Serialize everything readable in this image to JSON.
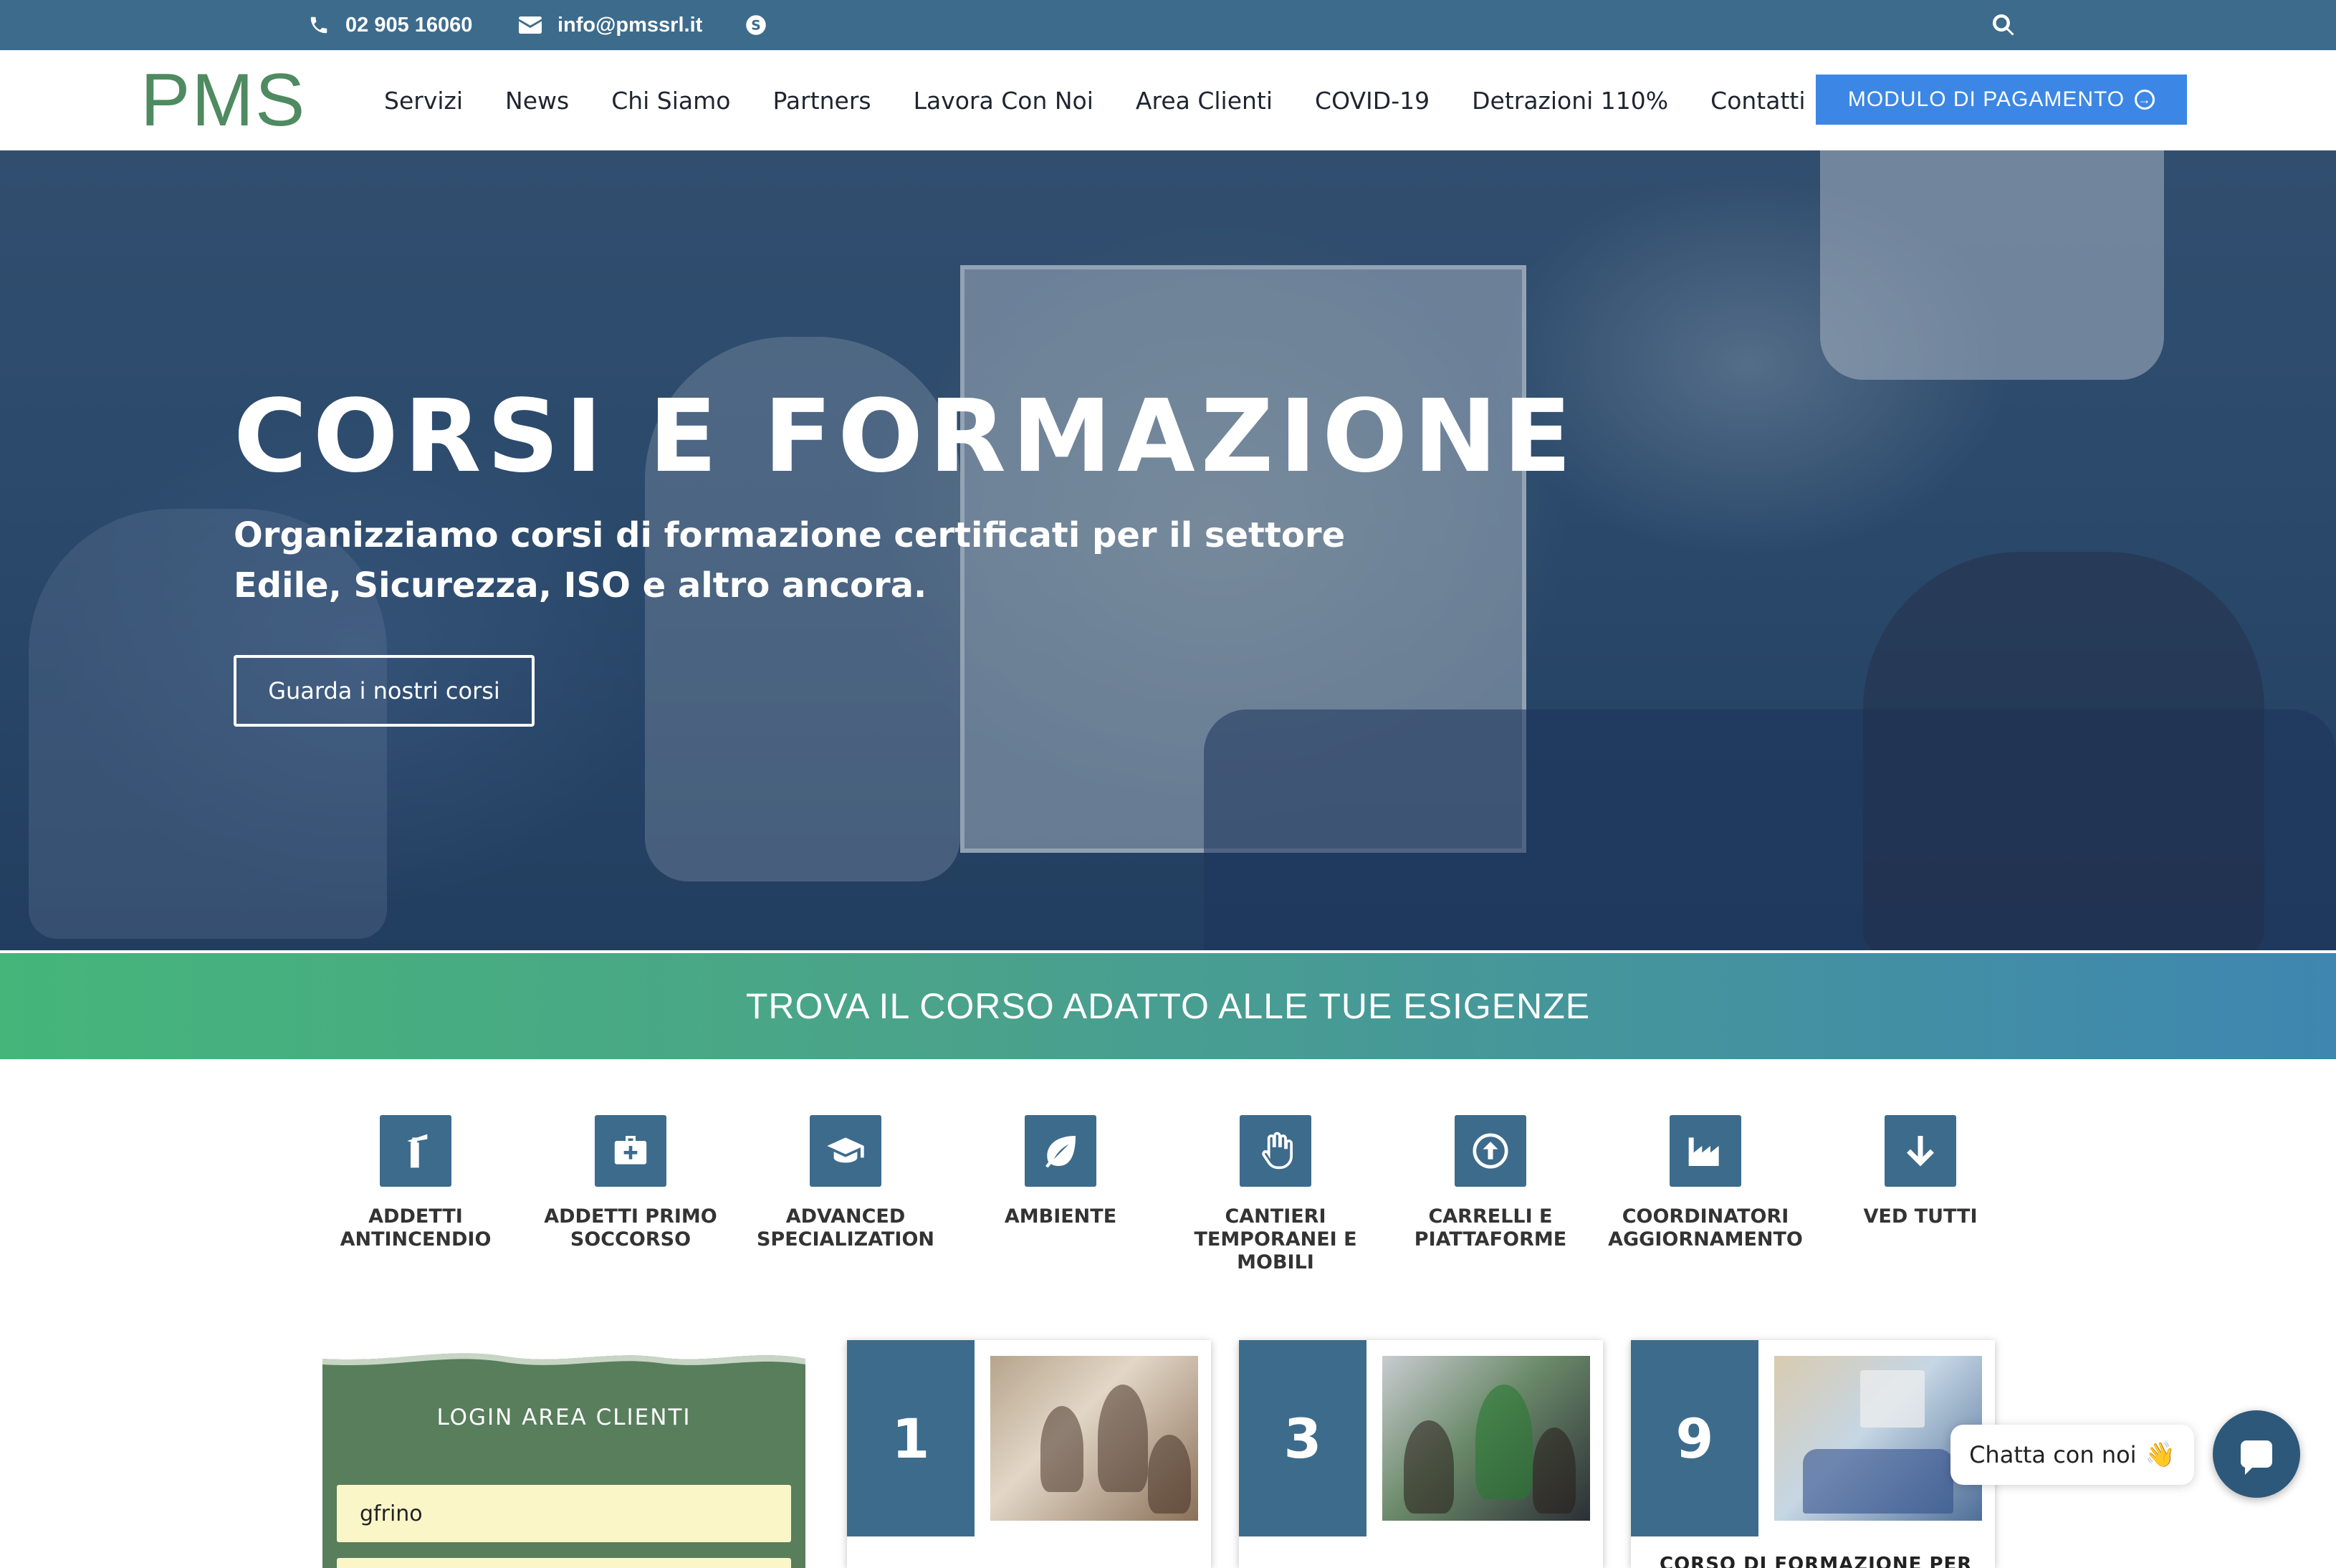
{
  "topbar": {
    "phone": "02 905 16060",
    "email": "info@pmssrl.it",
    "icons": [
      "phone-icon",
      "envelope-icon",
      "skype-icon",
      "search-icon"
    ]
  },
  "nav": {
    "logo": "PMS",
    "links": [
      "Servizi",
      "News",
      "Chi Siamo",
      "Partners",
      "Lavora Con Noi",
      "Area Clienti",
      "COVID-19",
      "Detrazioni 110%",
      "Contatti"
    ],
    "payment_button": "MODULO DI PAGAMENTO"
  },
  "hero": {
    "title": "CORSI E FORMAZIONE",
    "subtitle": "Organizziamo corsi di formazione certificati per il settore Edile, Sicurezza, ISO e altro ancora.",
    "cta": "Guarda i nostri corsi"
  },
  "banner": {
    "text": "TROVA IL CORSO ADATTO ALLE TUE ESIGENZE"
  },
  "categories": [
    {
      "label": "ADDETTI ANTINCENDIO",
      "icon": "fire-extinguisher-icon"
    },
    {
      "label": "ADDETTI PRIMO SOCCORSO",
      "icon": "first-aid-kit-icon"
    },
    {
      "label": "ADVANCED SPECIALIZATION",
      "icon": "graduation-cap-icon"
    },
    {
      "label": "AMBIENTE",
      "icon": "leaf-icon"
    },
    {
      "label": "CANTIERI TEMPORANEI E MOBILI",
      "icon": "hand-icon"
    },
    {
      "label": "CARRELLI E PIATTAFORME",
      "icon": "arrow-up-circle-icon"
    },
    {
      "label": "COORDINATORI AGGIORNAMENTO",
      "icon": "industry-icon"
    },
    {
      "label": "VED TUTTI",
      "icon": "arrow-down-icon"
    }
  ],
  "login": {
    "title": "LOGIN AREA CLIENTI",
    "username_value": "gfrino"
  },
  "cards": [
    {
      "number": "1",
      "text": ""
    },
    {
      "number": "3",
      "text": ""
    },
    {
      "number": "9",
      "text": "CORSO DI FORMAZIONE PER"
    }
  ],
  "chat": {
    "label": "Chatta con noi",
    "emoji": "👋"
  },
  "colors": {
    "primary": "#3d6b8c",
    "logo_green": "#4f8a61",
    "button_blue": "#3c87e5",
    "login_green": "#587e5c"
  }
}
